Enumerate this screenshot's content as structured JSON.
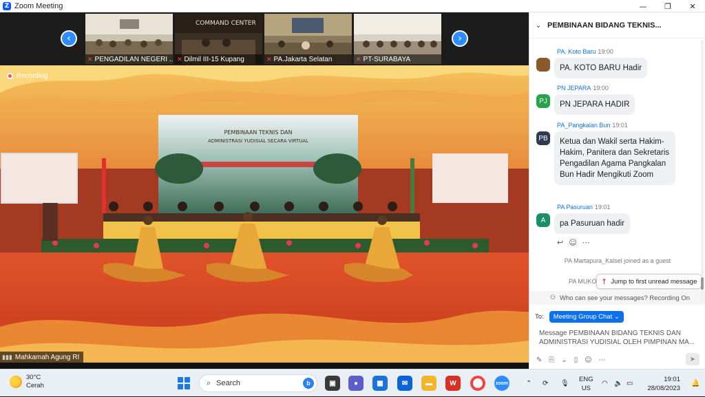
{
  "window": {
    "title": "Zoom Meeting",
    "controls": {
      "minimize": "—",
      "maximize": "❐",
      "close": "✕"
    }
  },
  "thumbnails": [
    {
      "name": "PENGADILAN NEGERI ..."
    },
    {
      "name": "Dilmil III-15 Kupang"
    },
    {
      "name": "PA.Jakarta Selatan"
    },
    {
      "name": "PT-SURABAYA"
    }
  ],
  "main_video": {
    "recording_label": "Recording",
    "speaker": "Mahkamah Agung RI",
    "banner_line1": "PEMBINAAN TEKNIS DAN",
    "banner_line2": "ADMINISTRASI YUDISIAL SECARA VIRTUAL"
  },
  "chat": {
    "header_title": "PEMBINAAN BIDANG TEKNIS...",
    "messages": [
      {
        "initials": "",
        "color": "#8a5a2b",
        "sender": "PA. Koto Baru",
        "time": "19:00",
        "text": "PA. KOTO BARU Hadir"
      },
      {
        "initials": "PJ",
        "color": "#27a348",
        "sender": "PN JEPARA",
        "time": "19:00",
        "text": "PN JEPARA HADIR"
      },
      {
        "initials": "PB",
        "color": "#2f3b52",
        "sender": "PA_Pangkalan Bun",
        "time": "19:01",
        "text": "Ketua dan Wakil serta Hakim-Hakim, Panitera dan Sekretaris Pengadilan Agama Pangkalan Bun Hadir Mengikuti Zoom"
      },
      {
        "initials": "A",
        "color": "#1a8f6a",
        "sender": "PA Pasuruan",
        "time": "19:01",
        "text": "pa Pasuruan hadir"
      }
    ],
    "system_message_1": "PA Martapura_Kalsel joined as a guest",
    "system_message_2_partial": "PA MUKO",
    "jump_button": "Jump to first unread message",
    "who_can_see": "Who can see your messages? Recording On",
    "to_label": "To:",
    "recipient": "Meeting Group Chat ⌄",
    "compose_text": "Message PEMBINAAN BIDANG TEKNIS DAN ADMINISTRASI YUDISIAL OLEH PIMPINAN MA..."
  },
  "taskbar": {
    "weather_temp": "30°C",
    "weather_desc": "Cerah",
    "search_placeholder": "Search",
    "lang_1": "ENG",
    "lang_2": "US",
    "time": "19:01",
    "date": "28/08/2023"
  }
}
